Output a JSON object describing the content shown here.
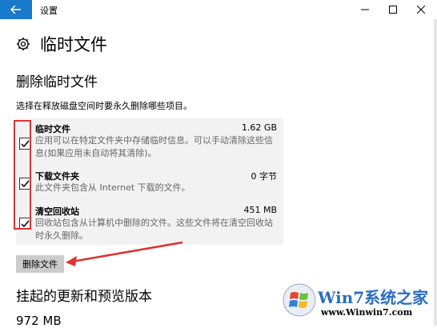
{
  "window": {
    "title": "设置",
    "back_icon": "back-arrow-icon",
    "accent_color": "#1979ca"
  },
  "page": {
    "icon": "gear-icon",
    "title": "临时文件"
  },
  "delete_section": {
    "title": "删除临时文件",
    "description": "选择在释放磁盘空间时要永久删除哪些项目。",
    "items": [
      {
        "name": "临时文件",
        "size": "1.62 GB",
        "detail": "应用可以在特定文件夹中存储临时信息。可以手动清除这些信息(如果应用未自动将其清除)。",
        "checked": true
      },
      {
        "name": "下载文件夹",
        "size": "0 字节",
        "detail": "此文件夹包含从 Internet 下载的文件。",
        "checked": true
      },
      {
        "name": "清空回收站",
        "size": "451 MB",
        "detail": "回收站包含从计算机中删除的文件。这些文件将在清空回收站时永久删除。",
        "checked": true
      }
    ],
    "delete_button": "删除文件",
    "annotation_color": "#e03030"
  },
  "updates_section": {
    "title": "挂起的更新和预览版本",
    "size": "972 MB"
  },
  "watermark": {
    "brand": "Win7系统之家",
    "url": "www.Winwin7.com"
  }
}
